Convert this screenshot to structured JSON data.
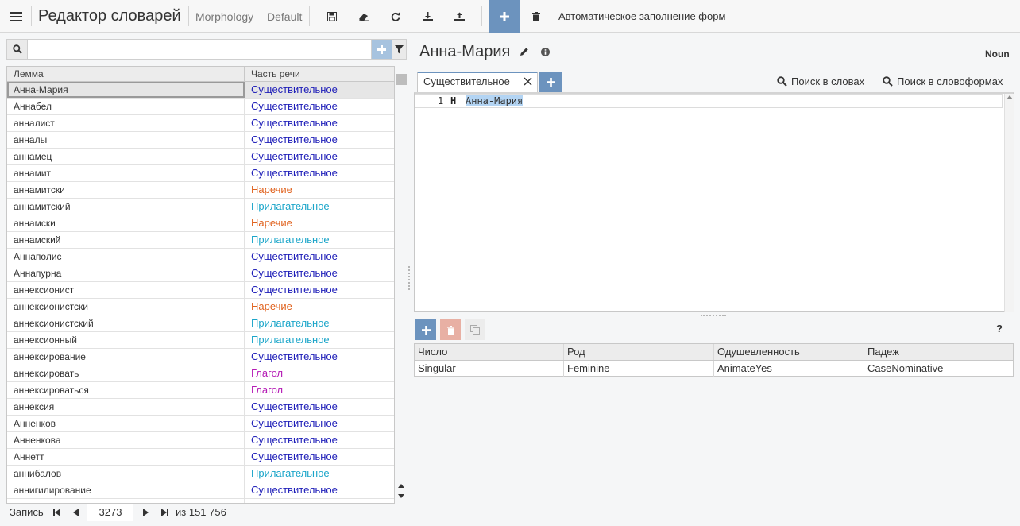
{
  "toolbar": {
    "title": "Редактор словарей",
    "module": "Morphology",
    "profile": "Default",
    "autofill_label": "Автоматическое заполнение форм",
    "accent": "#6c93be"
  },
  "search": {
    "value": "",
    "placeholder": ""
  },
  "grid": {
    "columns": [
      "Лемма",
      "Часть речи"
    ],
    "rows": [
      {
        "lemma": "Анна-Мария",
        "pos": "Существительное",
        "color": "#1d1db8",
        "selected": true
      },
      {
        "lemma": "Аннабел",
        "pos": "Существительное",
        "color": "#1d1db8"
      },
      {
        "lemma": "анналист",
        "pos": "Существительное",
        "color": "#1d1db8"
      },
      {
        "lemma": "анналы",
        "pos": "Существительное",
        "color": "#1d1db8"
      },
      {
        "lemma": "аннамец",
        "pos": "Существительное",
        "color": "#1d1db8"
      },
      {
        "lemma": "аннамит",
        "pos": "Существительное",
        "color": "#1d1db8"
      },
      {
        "lemma": "аннамитски",
        "pos": "Наречие",
        "color": "#e0621e"
      },
      {
        "lemma": "аннамитский",
        "pos": "Прилагательное",
        "color": "#1aa5c9"
      },
      {
        "lemma": "аннамски",
        "pos": "Наречие",
        "color": "#e0621e"
      },
      {
        "lemma": "аннамский",
        "pos": "Прилагательное",
        "color": "#1aa5c9"
      },
      {
        "lemma": "Аннаполис",
        "pos": "Существительное",
        "color": "#1d1db8"
      },
      {
        "lemma": "Аннапурна",
        "pos": "Существительное",
        "color": "#1d1db8"
      },
      {
        "lemma": "аннексионист",
        "pos": "Существительное",
        "color": "#1d1db8"
      },
      {
        "lemma": "аннексионистски",
        "pos": "Наречие",
        "color": "#e0621e"
      },
      {
        "lemma": "аннексионистский",
        "pos": "Прилагательное",
        "color": "#1aa5c9"
      },
      {
        "lemma": "аннексионный",
        "pos": "Прилагательное",
        "color": "#1aa5c9"
      },
      {
        "lemma": "аннексирование",
        "pos": "Существительное",
        "color": "#1d1db8"
      },
      {
        "lemma": "аннексировать",
        "pos": "Глагол",
        "color": "#b51bb5"
      },
      {
        "lemma": "аннексироваться",
        "pos": "Глагол",
        "color": "#b51bb5"
      },
      {
        "lemma": "аннексия",
        "pos": "Существительное",
        "color": "#1d1db8"
      },
      {
        "lemma": "Анненков",
        "pos": "Существительное",
        "color": "#1d1db8"
      },
      {
        "lemma": "Анненкова",
        "pos": "Существительное",
        "color": "#1d1db8"
      },
      {
        "lemma": "Аннетт",
        "pos": "Существительное",
        "color": "#1d1db8"
      },
      {
        "lemma": "аннибалов",
        "pos": "Прилагательное",
        "color": "#1aa5c9"
      },
      {
        "lemma": "аннигилирование",
        "pos": "Существительное",
        "color": "#1d1db8"
      },
      {
        "lemma": "",
        "pos": "",
        "color": "#b51bb5"
      }
    ]
  },
  "pager": {
    "label": "Запись",
    "current": "3273",
    "total": "из 151 756"
  },
  "detail": {
    "lemma": "Анна-Мария",
    "pos_tag": "Noun",
    "tab_label": "Существительное",
    "search_words": "Поиск в словах",
    "search_forms": "Поиск в словоформах",
    "editor": {
      "line_no": "1",
      "key": "Н",
      "value": "Анна-Мария"
    },
    "help": "?"
  },
  "features": {
    "columns": [
      "Число",
      "Род",
      "Одушевленность",
      "Падеж"
    ],
    "rows": [
      [
        "Singular",
        "Feminine",
        "AnimateYes",
        "CaseNominative"
      ]
    ]
  }
}
